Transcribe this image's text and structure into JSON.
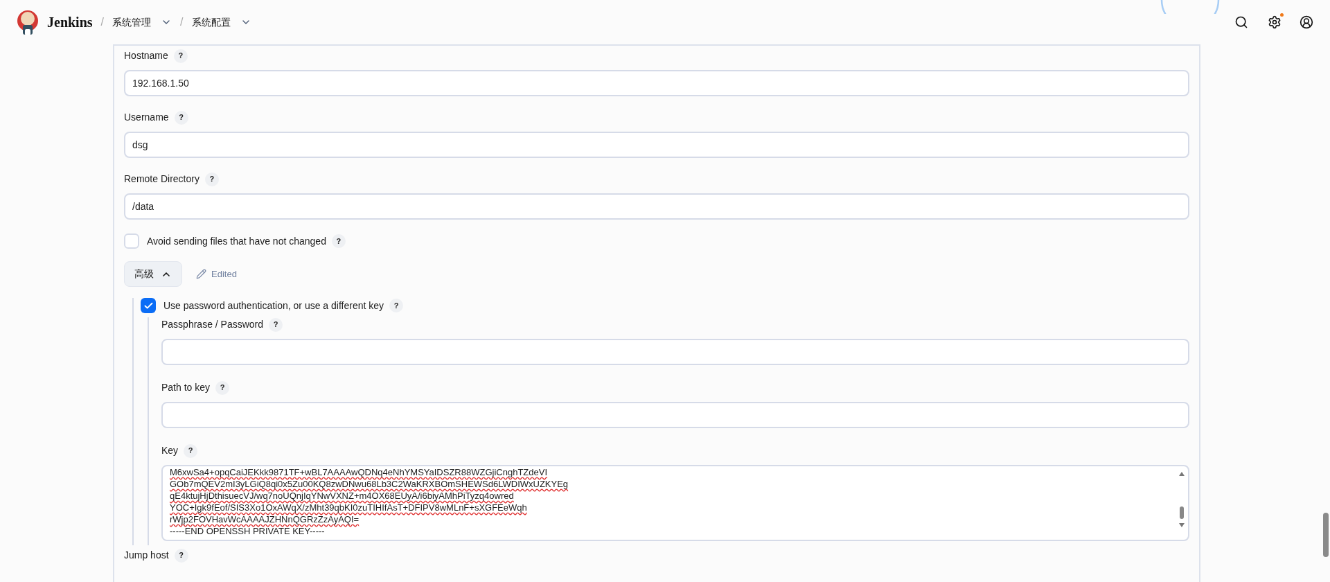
{
  "header": {
    "logo_text": "Jenkins",
    "breadcrumbs": [
      {
        "separator": "/",
        "label": "系统管理"
      },
      {
        "separator": "/",
        "label": "系统配置"
      }
    ],
    "settings_notification": true
  },
  "fields": [
    {
      "label": "Hostname",
      "help": "?",
      "value": "192.168.1.50"
    },
    {
      "label": "Username",
      "help": "?",
      "value": "dsg"
    },
    {
      "label": "Remote Directory",
      "help": "?",
      "value": "/data"
    }
  ],
  "avoid_sending": {
    "label": "Avoid sending files that have not changed",
    "help": "?",
    "checked": false
  },
  "advanced": {
    "label": "高级",
    "expanded": true,
    "edited_label": "Edited"
  },
  "password_auth": {
    "label": "Use password authentication, or use a different key",
    "help": "?",
    "checked": true,
    "fields": [
      {
        "label": "Passphrase / Password",
        "help": "?"
      },
      {
        "label": "Path to key",
        "help": "?"
      }
    ],
    "key": {
      "label": "Key",
      "help": "?",
      "lines": [
        "M6xwSa4+opqCaiJEKkk9871TF+wBL7AAAAwQDNq4eNhYMSYaIDSZR88WZGjiCnghTZdeVI",
        "GOb7mQEV2mI3yLGiQ8qi0x5Zu00KQ8zwDNwu68Lb3C2WaKRXBOmSHEWSd6LWDIWxUZKYEg",
        "qE4ktujHjDthisuecVJ/wq7noUQnjIqYNwVXNZ+m4OX68EUyA/i6biyAMhPiTyzq4owred",
        "YOC+Igk9fEof/SIS3Xo1OxAWqX/zMht39qbKI0zuTIHIfAsT+DFIPV8wMLnF+sXGFEeWqh",
        "rWjp2FOVHavWcAAAAJZHNnQGRzZzAyAQI=",
        "-----END OPENSSH PRIVATE KEY-----"
      ]
    }
  },
  "jump_host": {
    "label": "Jump host",
    "help": "?"
  }
}
